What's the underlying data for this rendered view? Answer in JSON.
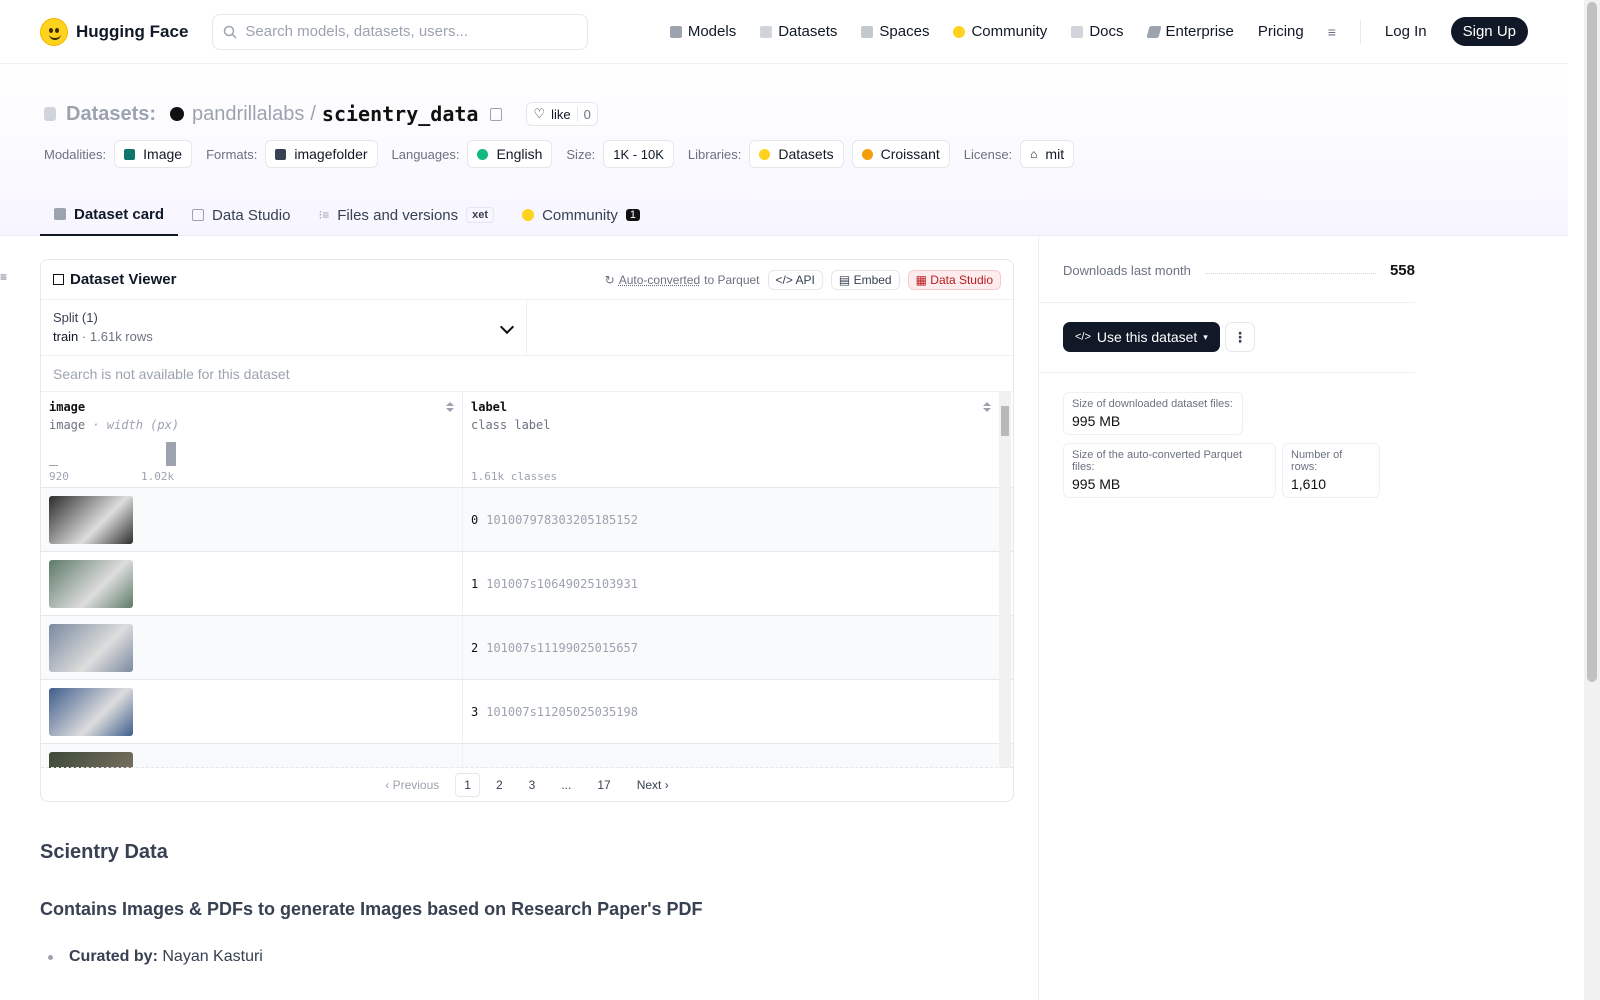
{
  "nav": {
    "brand": "Hugging Face",
    "search_placeholder": "Search models, datasets, users...",
    "items": [
      "Models",
      "Datasets",
      "Spaces",
      "Community",
      "Docs",
      "Enterprise",
      "Pricing"
    ],
    "login": "Log In",
    "signup": "Sign Up"
  },
  "repo": {
    "kind": "Datasets:",
    "owner": "pandrillalabs",
    "sep": "/",
    "name": "scientry_data",
    "like_label": "like",
    "like_count": "0"
  },
  "meta": {
    "modalities_label": "Modalities:",
    "modalities": "Image",
    "formats_label": "Formats:",
    "formats": "imagefolder",
    "languages_label": "Languages:",
    "languages": "English",
    "size_label": "Size:",
    "size": "1K - 10K",
    "libraries_label": "Libraries:",
    "lib1": "Datasets",
    "lib2": "Croissant",
    "license_label": "License:",
    "license": "mit"
  },
  "tabs": {
    "card": "Dataset card",
    "studio": "Data Studio",
    "files": "Files and versions",
    "xet": "xet",
    "community": "Community",
    "community_count": "1"
  },
  "viewer": {
    "title": "Dataset Viewer",
    "auto_converted": "Auto-converted",
    "to_parquet": "to Parquet",
    "api": "API",
    "embed": "Embed",
    "data_studio": "Data Studio",
    "split_label": "Split (1)",
    "split_value": "train",
    "split_dot": "·",
    "split_rows": "1.61k rows",
    "search_na": "Search is not available for this dataset",
    "col1_name": "image",
    "col1_type": "image",
    "col1_sub": "· width (px)",
    "col1_min": "920",
    "col1_max": "1.02k",
    "col2_name": "label",
    "col2_type": "class label",
    "col2_classes": "1.61k classes",
    "rows": [
      {
        "idx": "0",
        "val": "101007978303205185152",
        "thumb": "#2b2b2b"
      },
      {
        "idx": "1",
        "val": "101007s10649025103931",
        "thumb": "#5d7a68"
      },
      {
        "idx": "2",
        "val": "101007s11199025015657",
        "thumb": "#7a8aa0"
      },
      {
        "idx": "3",
        "val": "101007s11205025035198",
        "thumb": "#3f5d8c"
      }
    ],
    "pager": {
      "prev": "Previous",
      "p1": "1",
      "p2": "2",
      "p3": "3",
      "ellipsis": "...",
      "last": "17",
      "next": "Next"
    }
  },
  "card": {
    "h2": "Scientry Data",
    "h3": "Contains Images & PDFs to generate Images based on Research Paper's PDF",
    "li_label": "Curated by:",
    "li_value": "Nayan Kasturi"
  },
  "side": {
    "downloads_label": "Downloads last month",
    "downloads_value": "558",
    "use_button": "Use this dataset",
    "dl_size_label": "Size of downloaded dataset files:",
    "dl_size_value": "995 MB",
    "parquet_label": "Size of the auto-converted Parquet files:",
    "parquet_value": "995 MB",
    "rows_label": "Number of rows:",
    "rows_value": "1,610"
  },
  "colors": {
    "brand": "#FFD21E",
    "dark": "#111827",
    "studio": "#b91c1c"
  }
}
